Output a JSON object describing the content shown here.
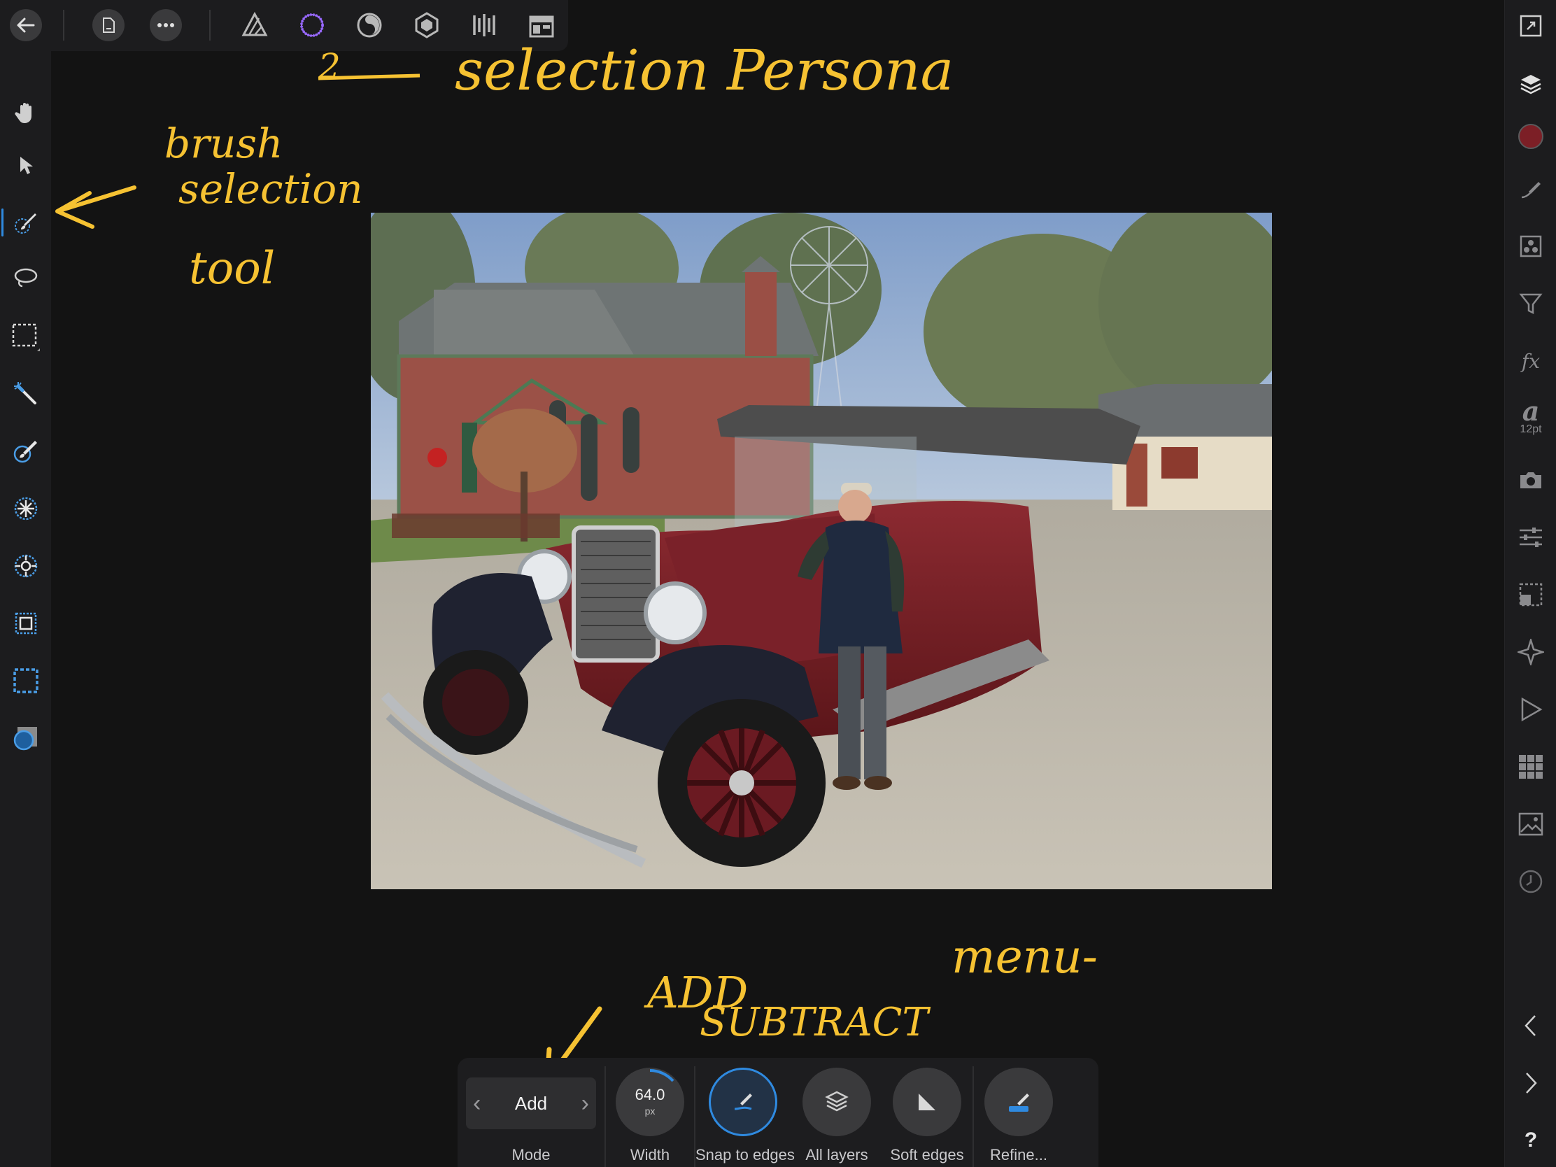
{
  "annotations": {
    "persona_note": "selection Persona",
    "persona_mark": "2",
    "brush_note_line1": "brush",
    "brush_note_line2": "selection",
    "brush_note_line3": "tool",
    "menu_note_line1": "ADD",
    "menu_note_line2": "SUBTRACT",
    "menu_note_line3": "menu-"
  },
  "top_bar": {
    "icons": [
      "back-arrow-icon",
      "document-icon",
      "more-icon",
      "photo-persona-icon",
      "selection-persona-icon",
      "liquify-persona-icon",
      "develop-persona-icon",
      "tone-mapping-persona-icon",
      "export-persona-icon"
    ]
  },
  "left_tools": {
    "icons": [
      "hand-icon",
      "move-icon",
      "selection-brush-icon",
      "freehand-selection-icon",
      "rectangular-marquee-icon",
      "flood-select-icon",
      "paint-brush-icon",
      "dodge-burn-icon",
      "clone-icon",
      "crop-icon",
      "mask-icon",
      "quick-mask-icon"
    ],
    "active": "selection-brush-icon"
  },
  "right_bar": {
    "text_size": "12pt",
    "help": "?",
    "colors": {
      "color_swatch": "#7c1f26",
      "accent": "#2f8ae0"
    }
  },
  "context_toolbar": {
    "mode": {
      "value": "Add",
      "label": "Mode"
    },
    "width": {
      "value": "64.0",
      "unit": "px",
      "label": "Width"
    },
    "snap_to_edges": {
      "label": "Snap to edges"
    },
    "all_layers": {
      "label": "All layers"
    },
    "soft_edges": {
      "label": "Soft edges"
    },
    "refine": {
      "label": "Refine..."
    }
  }
}
